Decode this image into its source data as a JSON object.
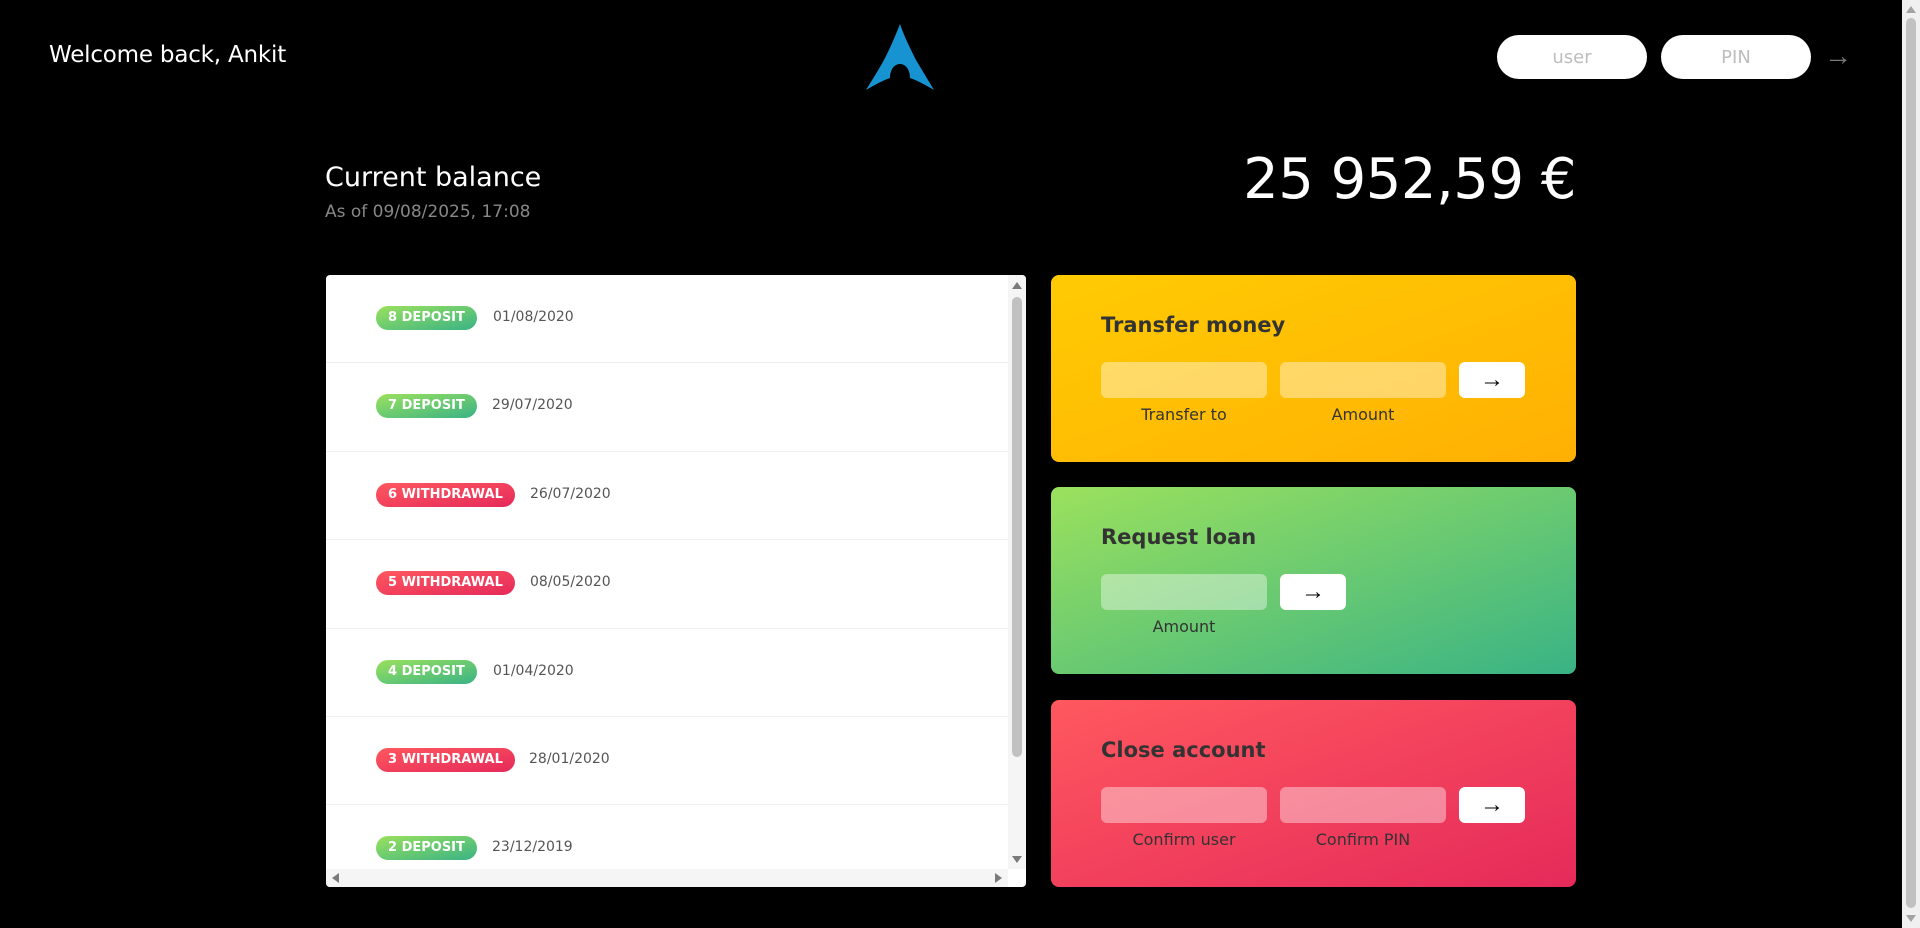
{
  "header": {
    "welcome": "Welcome back, Ankit",
    "login_user_placeholder": "user",
    "login_pin_placeholder": "PIN",
    "login_button": "→"
  },
  "balance": {
    "label": "Current balance",
    "date": "As of 09/08/2025, 17:08",
    "value": "25 952,59 €"
  },
  "movements": [
    {
      "type_label": "8 DEPOSIT",
      "kind": "deposit",
      "date": "01/08/2020"
    },
    {
      "type_label": "7 DEPOSIT",
      "kind": "deposit",
      "date": "29/07/2020"
    },
    {
      "type_label": "6 WITHDRAWAL",
      "kind": "withdrawal",
      "date": "26/07/2020"
    },
    {
      "type_label": "5 WITHDRAWAL",
      "kind": "withdrawal",
      "date": "08/05/2020"
    },
    {
      "type_label": "4 DEPOSIT",
      "kind": "deposit",
      "date": "01/04/2020"
    },
    {
      "type_label": "3 WITHDRAWAL",
      "kind": "withdrawal",
      "date": "28/01/2020"
    },
    {
      "type_label": "2 DEPOSIT",
      "kind": "deposit",
      "date": "23/12/2019"
    }
  ],
  "operations": {
    "transfer": {
      "title": "Transfer money",
      "to_label": "Transfer to",
      "amount_label": "Amount",
      "button": "→"
    },
    "loan": {
      "title": "Request loan",
      "amount_label": "Amount",
      "button": "→"
    },
    "close": {
      "title": "Close account",
      "user_label": "Confirm user",
      "pin_label": "Confirm PIN",
      "button": "→"
    }
  },
  "colors": {
    "deposit": "#39b385",
    "withdrawal": "#e52a5a",
    "transfer": "#ffb003",
    "logo": "#1793d1"
  }
}
